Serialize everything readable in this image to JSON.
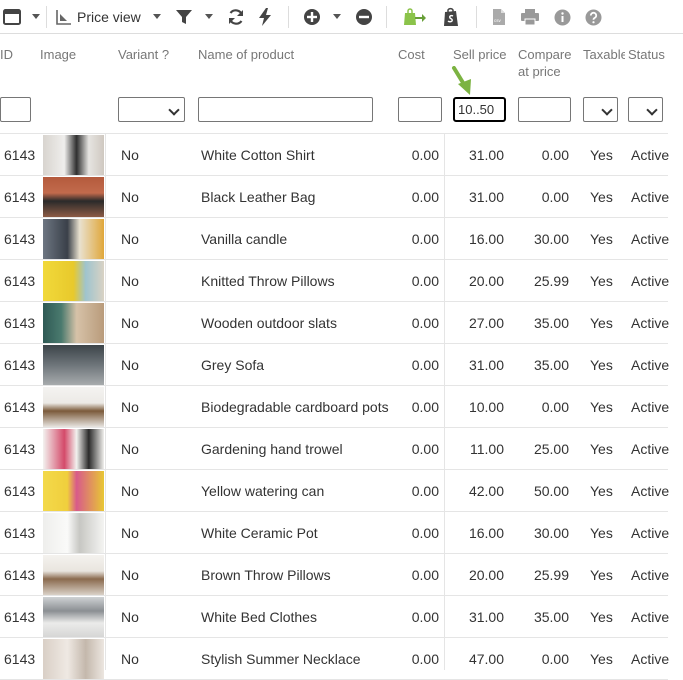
{
  "toolbar": {
    "price_view_label": "Price view",
    "icons": [
      "window-icon",
      "price-tag-icon",
      "filter-icon",
      "refresh-icon",
      "lightning-icon",
      "add-icon",
      "remove-icon",
      "shopify-export-icon",
      "shopify-icon",
      "csv-icon",
      "print-icon",
      "info-icon",
      "help-icon"
    ],
    "csv_text": "csv"
  },
  "columns": {
    "id": "ID",
    "image": "Image",
    "variant": "Variant ?",
    "name": "Name of product",
    "cost": "Cost",
    "sell": "Sell price",
    "compare": "Compare at price",
    "taxable": "Taxable",
    "status": "Status"
  },
  "filters": {
    "sell_price_value": "10..50"
  },
  "rows": [
    {
      "id": "6143",
      "variant": "No",
      "name": "White Cotton Shirt",
      "cost": "0.00",
      "sell": "31.00",
      "compare": "0.00",
      "taxable": "Yes",
      "status": "Active"
    },
    {
      "id": "6143",
      "variant": "No",
      "name": "Black Leather Bag",
      "cost": "0.00",
      "sell": "31.00",
      "compare": "0.00",
      "taxable": "Yes",
      "status": "Active"
    },
    {
      "id": "6143",
      "variant": "No",
      "name": "Vanilla candle",
      "cost": "0.00",
      "sell": "16.00",
      "compare": "30.00",
      "taxable": "Yes",
      "status": "Active"
    },
    {
      "id": "6143",
      "variant": "No",
      "name": "Knitted Throw Pillows",
      "cost": "0.00",
      "sell": "20.00",
      "compare": "25.99",
      "taxable": "Yes",
      "status": "Active"
    },
    {
      "id": "6143",
      "variant": "No",
      "name": "Wooden outdoor slats",
      "cost": "0.00",
      "sell": "27.00",
      "compare": "35.00",
      "taxable": "Yes",
      "status": "Active"
    },
    {
      "id": "6143",
      "variant": "No",
      "name": "Grey Sofa",
      "cost": "0.00",
      "sell": "31.00",
      "compare": "35.00",
      "taxable": "Yes",
      "status": "Active"
    },
    {
      "id": "6143",
      "variant": "No",
      "name": "Biodegradable cardboard pots",
      "cost": "0.00",
      "sell": "10.00",
      "compare": "0.00",
      "taxable": "Yes",
      "status": "Active"
    },
    {
      "id": "6143",
      "variant": "No",
      "name": "Gardening hand trowel",
      "cost": "0.00",
      "sell": "11.00",
      "compare": "25.00",
      "taxable": "Yes",
      "status": "Active"
    },
    {
      "id": "6143",
      "variant": "No",
      "name": "Yellow watering can",
      "cost": "0.00",
      "sell": "42.00",
      "compare": "50.00",
      "taxable": "Yes",
      "status": "Active"
    },
    {
      "id": "6143",
      "variant": "No",
      "name": "White Ceramic Pot",
      "cost": "0.00",
      "sell": "16.00",
      "compare": "30.00",
      "taxable": "Yes",
      "status": "Active"
    },
    {
      "id": "6143",
      "variant": "No",
      "name": "Brown Throw Pillows",
      "cost": "0.00",
      "sell": "20.00",
      "compare": "25.99",
      "taxable": "Yes",
      "status": "Active"
    },
    {
      "id": "6143",
      "variant": "No",
      "name": "White Bed Clothes",
      "cost": "0.00",
      "sell": "31.00",
      "compare": "35.00",
      "taxable": "Yes",
      "status": "Active"
    },
    {
      "id": "6143",
      "variant": "No",
      "name": "Stylish Summer Necklace",
      "cost": "0.00",
      "sell": "47.00",
      "compare": "0.00",
      "taxable": "Yes",
      "status": "Active"
    }
  ],
  "colors": {
    "accent_green": "#7cb342",
    "shopify_green": "#8bc34a",
    "icon_dark": "#444",
    "icon_grey": "#999"
  }
}
